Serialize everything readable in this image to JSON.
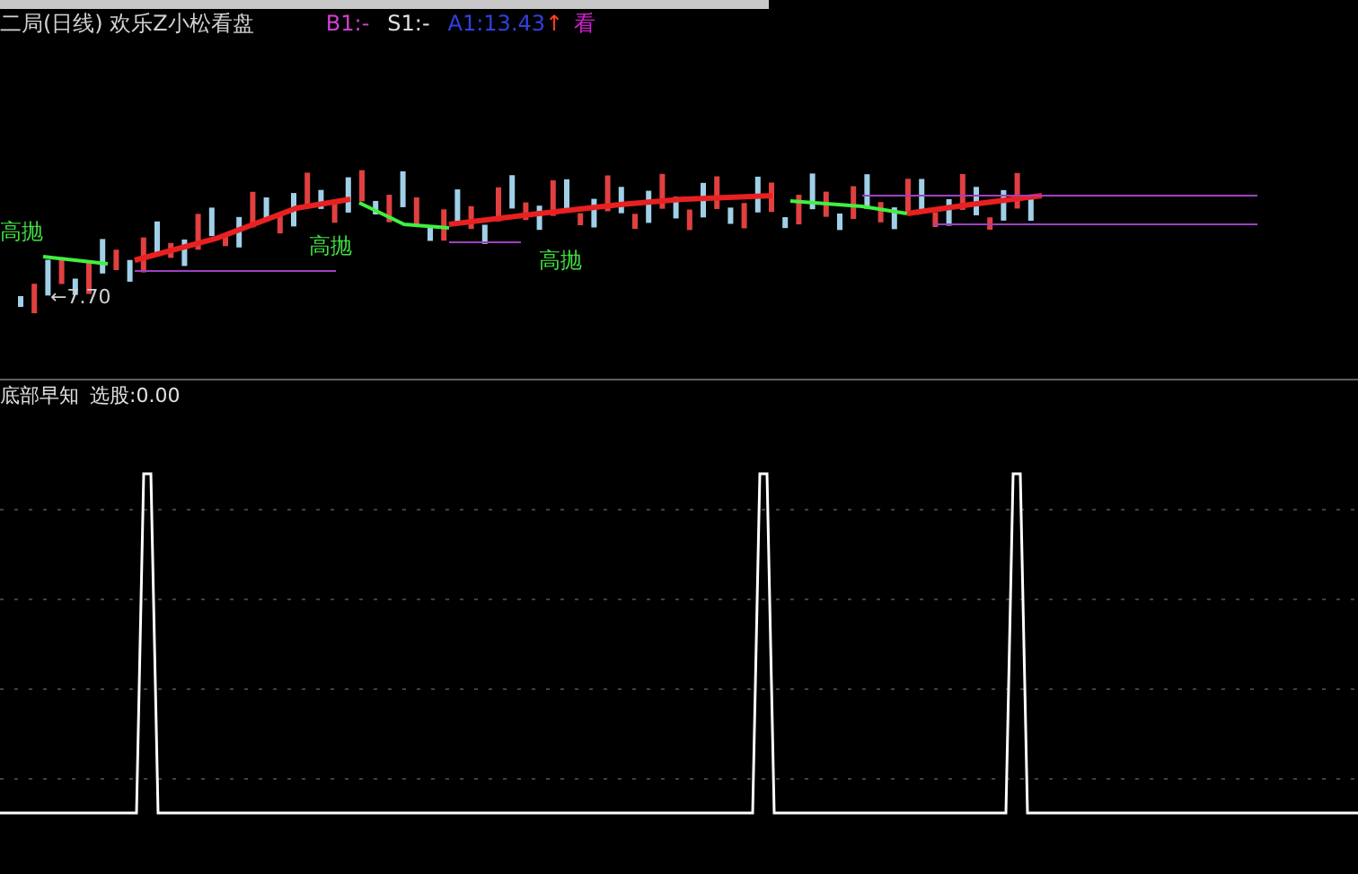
{
  "header": {
    "title": "二局(日线) 欢乐Z小松看盘",
    "b1": "B1:-",
    "s1": "S1:-",
    "a1": "A1:13.43",
    "arrow": "↑",
    "cut_label": "看"
  },
  "price_chart": {
    "signals": [
      "高抛",
      "高抛",
      "高抛"
    ],
    "price_label": "←7.70"
  },
  "indicator": {
    "name": "底部早知",
    "value": "选股:0.00"
  }
}
